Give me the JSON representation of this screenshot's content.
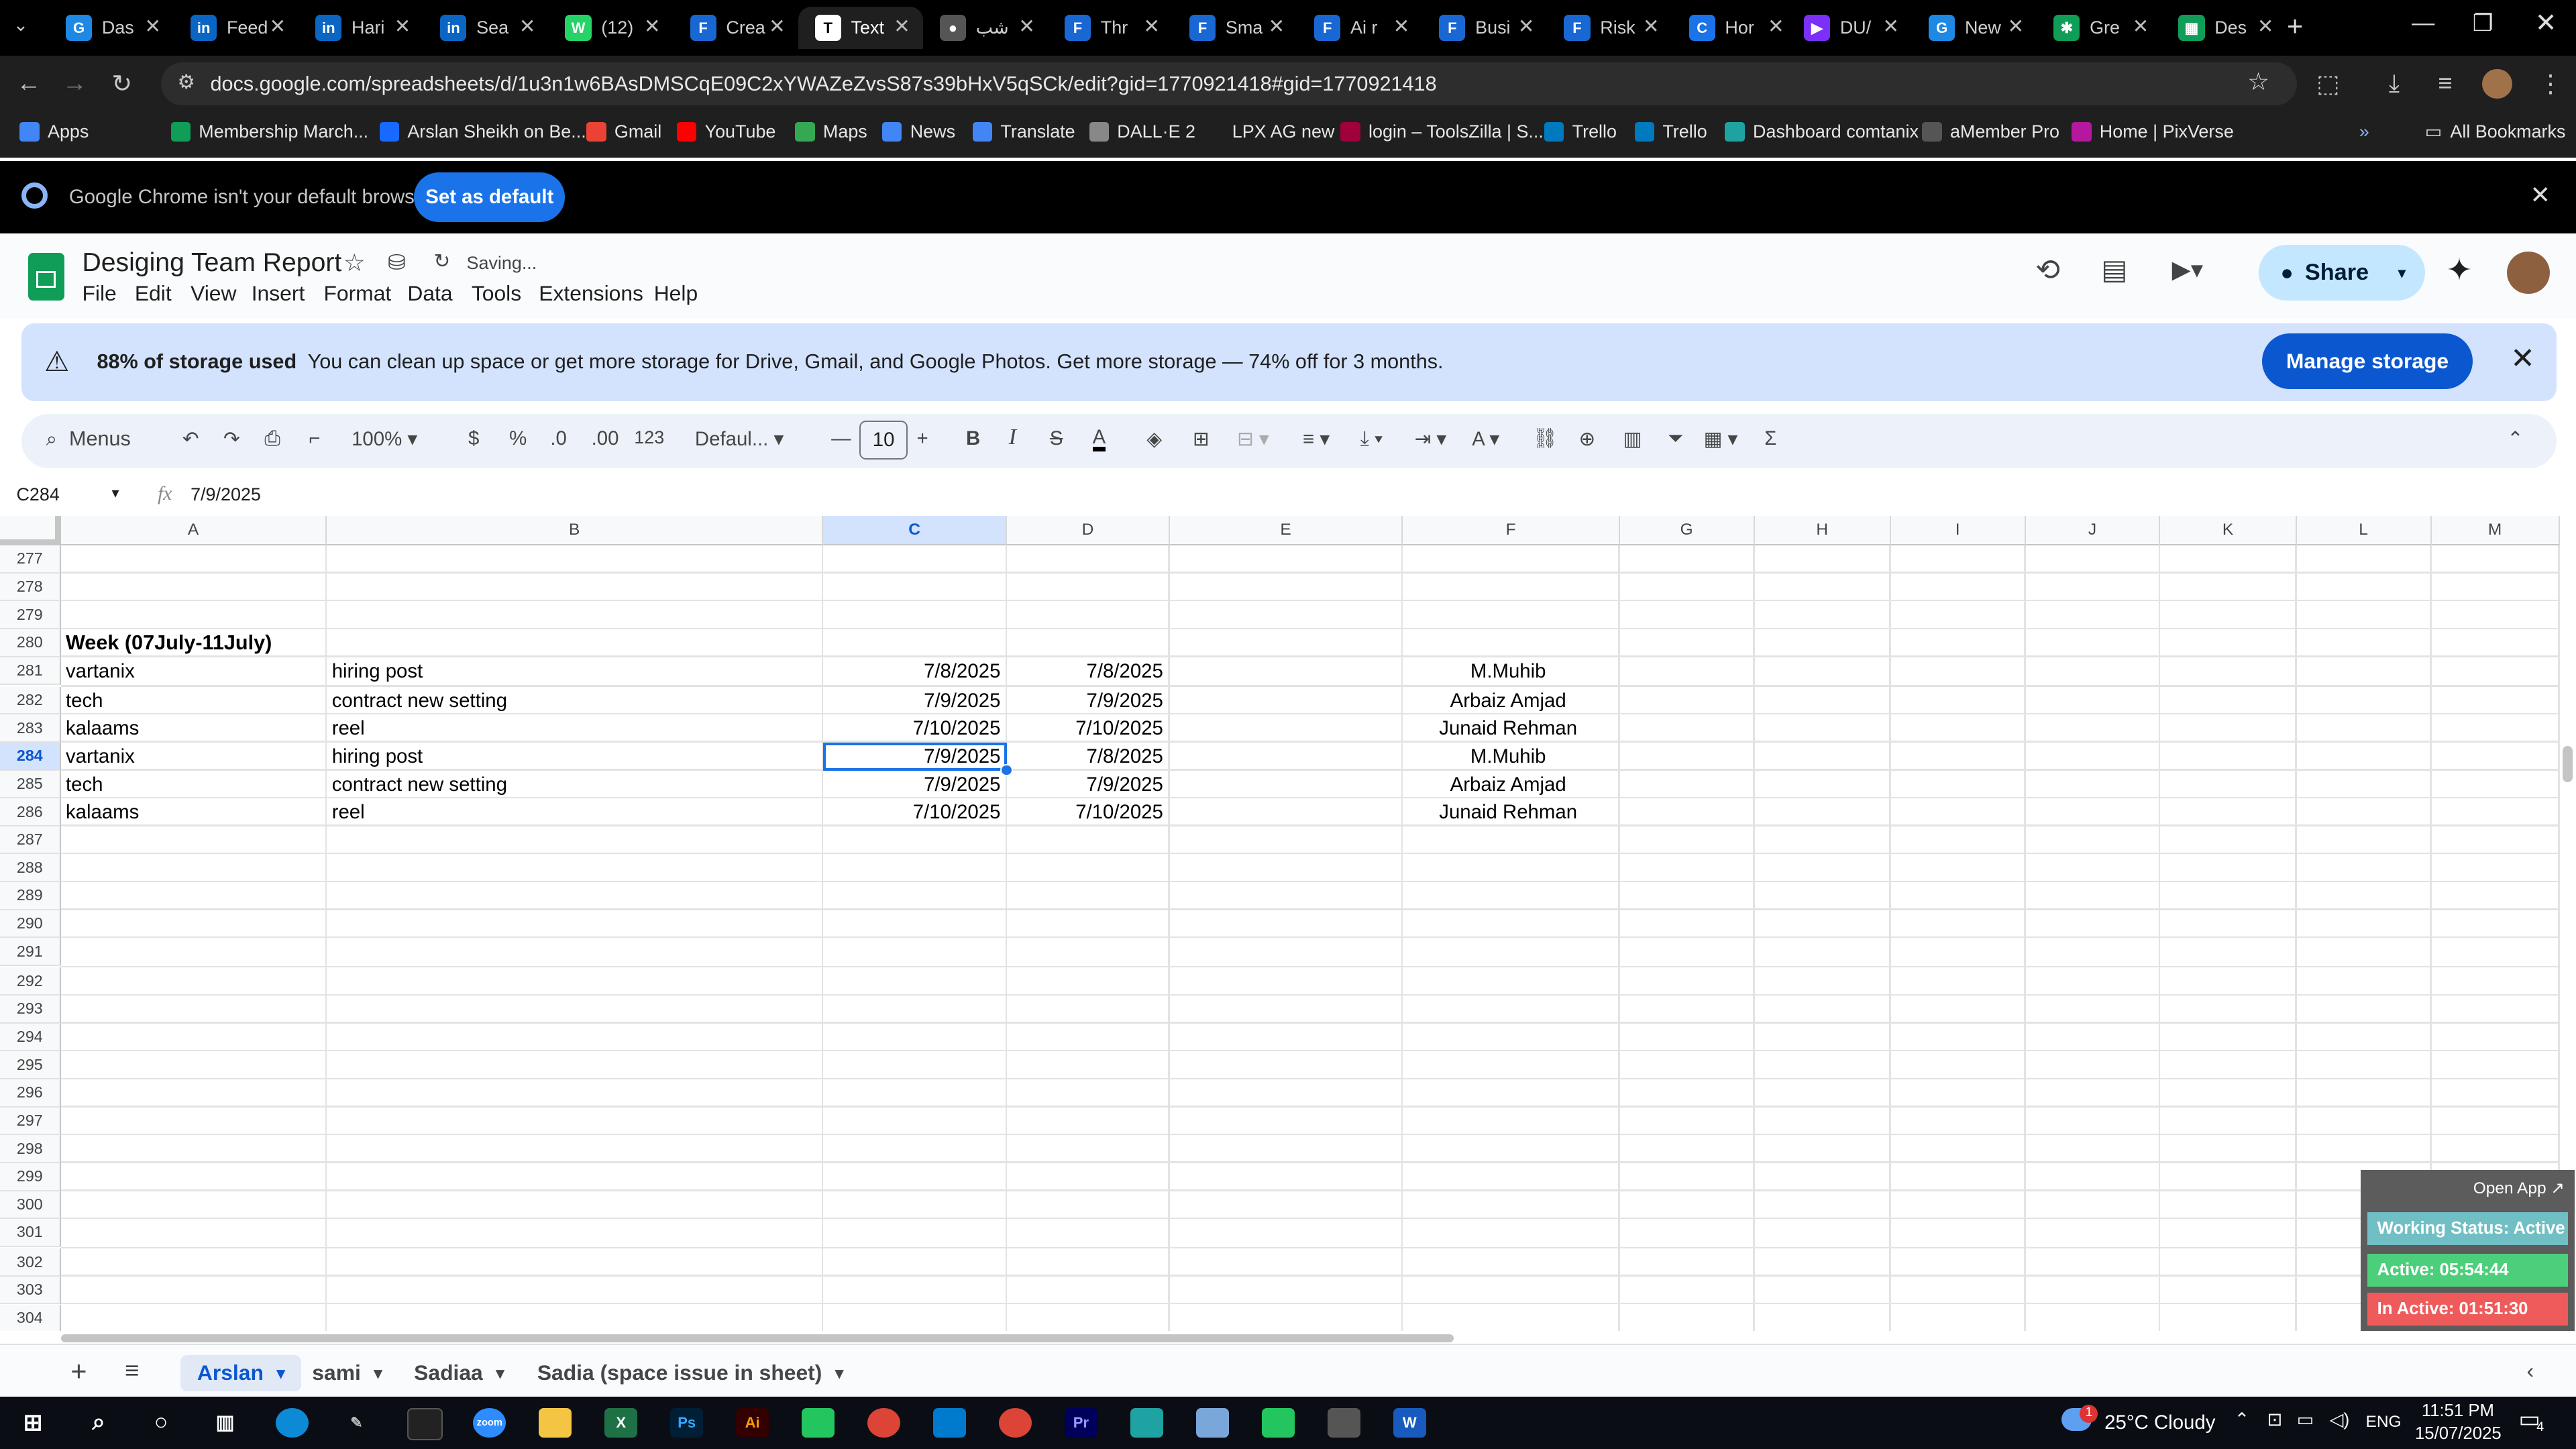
{
  "browser": {
    "tabs": [
      {
        "label": "Das",
        "color": "#1e88e5",
        "glyph": "G"
      },
      {
        "label": "Feed",
        "color": "#0a66c2",
        "glyph": "in"
      },
      {
        "label": "Hari",
        "color": "#0a66c2",
        "glyph": "in"
      },
      {
        "label": "Sea",
        "color": "#0a66c2",
        "glyph": "in"
      },
      {
        "label": "(12)",
        "color": "#25d366",
        "glyph": "W"
      },
      {
        "label": "Crea",
        "color": "#1967d2",
        "glyph": "F"
      },
      {
        "label": "Text",
        "color": "#ffffff",
        "glyph": "T",
        "active": true
      },
      {
        "label": "شب",
        "color": "#555555",
        "glyph": "●"
      },
      {
        "label": "Thr",
        "color": "#1967d2",
        "glyph": "F"
      },
      {
        "label": "Sma",
        "color": "#1967d2",
        "glyph": "F"
      },
      {
        "label": "Ai r",
        "color": "#1967d2",
        "glyph": "F"
      },
      {
        "label": "Busi",
        "color": "#1967d2",
        "glyph": "F"
      },
      {
        "label": "Risk",
        "color": "#1967d2",
        "glyph": "F"
      },
      {
        "label": "Hor",
        "color": "#1a73e8",
        "glyph": "C"
      },
      {
        "label": "DU/",
        "color": "#7b2ff7",
        "glyph": "▶"
      },
      {
        "label": "New",
        "color": "#1e88e5",
        "glyph": "G"
      },
      {
        "label": "Gre",
        "color": "#0f9d58",
        "glyph": "✱"
      },
      {
        "label": "Des",
        "color": "#0f9d58",
        "glyph": "▦"
      }
    ],
    "url": "docs.google.com/spreadsheets/d/1u3n1w6BAsDMSCqE09C2xYWAZeZvsS87s39bHxV5qSCk/edit?gid=1770921418#gid=1770921418",
    "bookmarks": [
      {
        "label": "Apps",
        "color": "#4285f4"
      },
      {
        "label": "Membership March...",
        "color": "#0f9d58"
      },
      {
        "label": "Arslan Sheikh on Be...",
        "color": "#1769ff"
      },
      {
        "label": "Gmail",
        "color": "#ea4335"
      },
      {
        "label": "YouTube",
        "color": "#ff0000"
      },
      {
        "label": "Maps",
        "color": "#34a853"
      },
      {
        "label": "News",
        "color": "#4285f4"
      },
      {
        "label": "Translate",
        "color": "#4285f4"
      },
      {
        "label": "DALL·E 2",
        "color": "#888888"
      },
      {
        "label": "LPX AG new",
        "color": "#1f1f1f"
      },
      {
        "label": "login – ToolsZilla | S...",
        "color": "#a0003c"
      },
      {
        "label": "Trello",
        "color": "#0079bf"
      },
      {
        "label": "Trello",
        "color": "#0079bf"
      },
      {
        "label": "Dashboard comtanix",
        "color": "#1fa2a2"
      },
      {
        "label": "aMember Pro",
        "color": "#555555"
      },
      {
        "label": "Home | PixVerse",
        "color": "#b5179e"
      }
    ],
    "all_bookmarks": "All Bookmarks",
    "default_notice": "Google Chrome isn't your default browser",
    "set_default_label": "Set as default"
  },
  "sheets": {
    "title": "Desiging Team Report",
    "status": "Saving...",
    "menu": [
      "File",
      "Edit",
      "View",
      "Insert",
      "Format",
      "Data",
      "Tools",
      "Extensions",
      "Help"
    ],
    "share_label": "Share",
    "storage": {
      "bold": "88% of storage used",
      "text": "You can clean up space or get more storage for Drive, Gmail, and Google Photos. Get more storage — 74% off for 3 months.",
      "button": "Manage storage"
    },
    "toolbar": {
      "menus_label": "Menus",
      "zoom": "100%",
      "currency": "$",
      "percent": "%",
      "dec_decrease": ".0",
      "dec_increase": ".00",
      "number_format": "123",
      "font": "Defaul...",
      "font_size": "10"
    },
    "name_box": "C284",
    "formula": "7/9/2025",
    "columns": [
      "A",
      "B",
      "C",
      "D",
      "E",
      "F",
      "G",
      "H",
      "I",
      "J",
      "K",
      "L",
      "M"
    ],
    "rows": [
      {
        "n": "277",
        "a": "",
        "b": "",
        "c": "",
        "d": "",
        "f": ""
      },
      {
        "n": "278",
        "a": "",
        "b": "",
        "c": "",
        "d": "",
        "f": ""
      },
      {
        "n": "279",
        "a": "",
        "b": "",
        "c": "",
        "d": "",
        "f": ""
      },
      {
        "n": "280",
        "a": "Week (07July-11July)",
        "b": "",
        "c": "",
        "d": "",
        "f": "",
        "bold": true
      },
      {
        "n": "281",
        "a": "vartanix",
        "b": "hiring post",
        "c": "7/8/2025",
        "d": "7/8/2025",
        "f": "M.Muhib"
      },
      {
        "n": "282",
        "a": "tech",
        "b": "contract new setting",
        "c": "7/9/2025",
        "d": "7/9/2025",
        "f": "Arbaiz Amjad"
      },
      {
        "n": "283",
        "a": "kalaams",
        "b": "reel",
        "c": "7/10/2025",
        "d": "7/10/2025",
        "f": "Junaid Rehman"
      },
      {
        "n": "284",
        "a": "vartanix",
        "b": "hiring post",
        "c": "7/9/2025",
        "d": "7/8/2025",
        "f": "M.Muhib",
        "selected": true
      },
      {
        "n": "285",
        "a": "tech",
        "b": "contract new setting",
        "c": "7/9/2025",
        "d": "7/9/2025",
        "f": "Arbaiz Amjad"
      },
      {
        "n": "286",
        "a": "kalaams",
        "b": "reel",
        "c": "7/10/2025",
        "d": "7/10/2025",
        "f": "Junaid Rehman"
      },
      {
        "n": "287"
      },
      {
        "n": "288"
      },
      {
        "n": "289"
      },
      {
        "n": "290"
      },
      {
        "n": "291"
      },
      {
        "n": "292"
      },
      {
        "n": "293"
      },
      {
        "n": "294"
      },
      {
        "n": "295"
      },
      {
        "n": "296"
      },
      {
        "n": "297"
      },
      {
        "n": "298"
      },
      {
        "n": "299"
      },
      {
        "n": "300"
      },
      {
        "n": "301"
      },
      {
        "n": "302"
      },
      {
        "n": "303"
      },
      {
        "n": "304"
      }
    ],
    "sheet_tabs": [
      {
        "label": "Arslan",
        "active": true
      },
      {
        "label": "sami"
      },
      {
        "label": "Sadiaa"
      },
      {
        "label": "Sadia (space issue in sheet)"
      }
    ]
  },
  "tracker": {
    "open_app": "Open App ↗",
    "status": "Working Status: Active",
    "active": "Active: 05:54:44",
    "inactive": "In Active: 01:51:30",
    "colors": {
      "status": "#6fbfc4",
      "active": "#4ccf7a",
      "inactive": "#ef5a5a"
    }
  },
  "taskbar": {
    "weather": "25°C  Cloudy",
    "weather_badge": "1",
    "lang": "ENG",
    "time": "11:51 PM",
    "date": "15/07/2025",
    "notif_count": "4"
  }
}
